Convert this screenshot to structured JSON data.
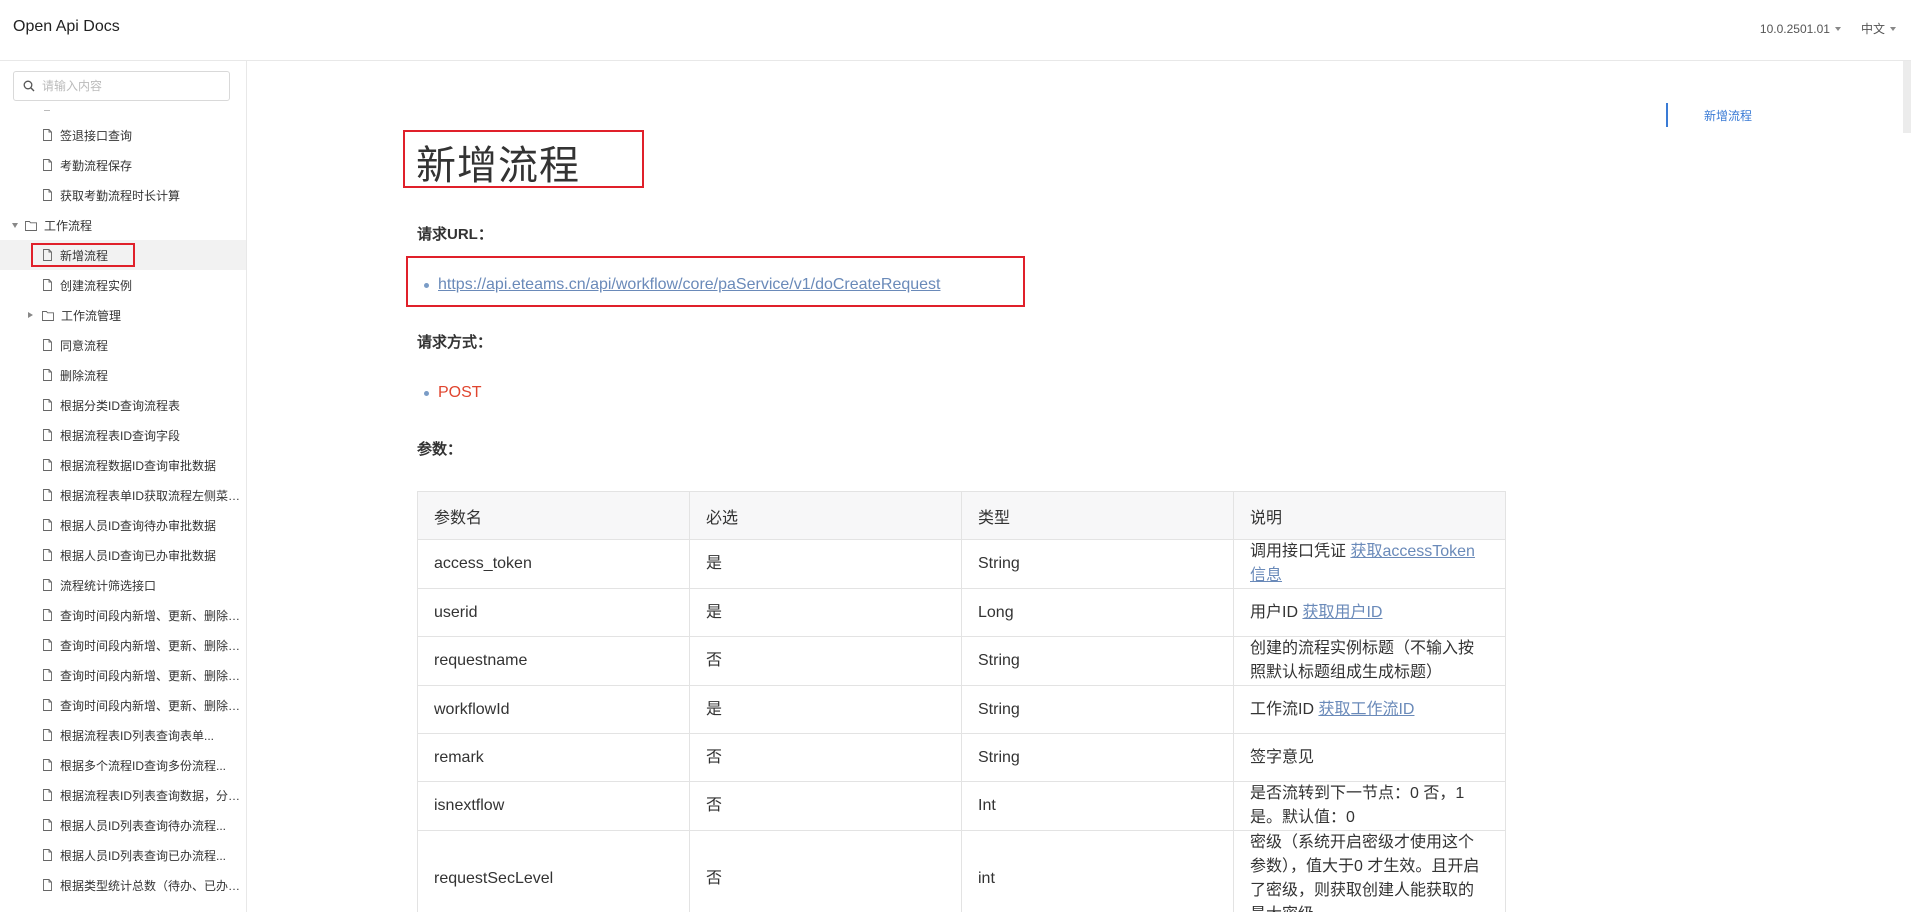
{
  "header": {
    "brand": "Open Api Docs",
    "version": "10.0.2501.01",
    "language": "中文"
  },
  "sidebar": {
    "search_placeholder": "请输入内容",
    "items_top": [
      {
        "label": "签退接口查询"
      },
      {
        "label": "考勤流程保存"
      },
      {
        "label": "获取考勤流程时长计算"
      }
    ],
    "folder": {
      "label": "工作流程"
    },
    "items": [
      {
        "label": "新增流程",
        "active": true
      },
      {
        "label": "创建流程实例"
      },
      {
        "label": "工作流管理",
        "folder": true
      },
      {
        "label": "同意流程"
      },
      {
        "label": "删除流程"
      },
      {
        "label": "根据分类ID查询流程表"
      },
      {
        "label": "根据流程表ID查询字段"
      },
      {
        "label": "根据流程数据ID查询审批数据"
      },
      {
        "label": "根据流程表单ID获取流程左侧菜单..."
      },
      {
        "label": "根据人员ID查询待办审批数据"
      },
      {
        "label": "根据人员ID查询已办审批数据"
      },
      {
        "label": "流程统计筛选接口"
      },
      {
        "label": "查询时间段内新增、更新、删除的..."
      },
      {
        "label": "查询时间段内新增、更新、删除三..."
      },
      {
        "label": "查询时间段内新增、更新、删除的..."
      },
      {
        "label": "查询时间段内新增、更新、删除三..."
      },
      {
        "label": "根据流程表ID列表查询表单..."
      },
      {
        "label": "根据多个流程ID查询多份流程..."
      },
      {
        "label": "根据流程表ID列表查询数据，分页..."
      },
      {
        "label": "根据人员ID列表查询待办流程..."
      },
      {
        "label": "根据人员ID列表查询已办流程..."
      },
      {
        "label": "根据类型统计总数（待办、已办、..."
      }
    ]
  },
  "main": {
    "title": "新增流程",
    "url_heading": "请求URL：",
    "url": "https://api.eteams.cn/api/workflow/core/paService/v1/doCreateRequest",
    "method_heading": "请求方式：",
    "method": "POST",
    "params_heading": "参数：",
    "table": {
      "headers": [
        "参数名",
        "必选",
        "类型",
        "说明"
      ],
      "rows": [
        {
          "name": "access_token",
          "required": "是",
          "type": "String",
          "desc": "调用接口凭证 ",
          "link": "获取accessToken信息"
        },
        {
          "name": "userid",
          "required": "是",
          "type": "Long",
          "desc": "用户ID ",
          "link": "获取用户ID"
        },
        {
          "name": "requestname",
          "required": "否",
          "type": "String",
          "desc": "创建的流程实例标题（不输入按照默认标题组成生成标题）",
          "link": ""
        },
        {
          "name": "workflowId",
          "required": "是",
          "type": "String",
          "desc": "工作流ID ",
          "link": "获取工作流ID"
        },
        {
          "name": "remark",
          "required": "否",
          "type": "String",
          "desc": "签字意见",
          "link": ""
        },
        {
          "name": "isnextflow",
          "required": "否",
          "type": "Int",
          "desc": "是否流转到下一节点：0 否，1 是。默认值：0",
          "link": ""
        },
        {
          "name": "requestSecLevel",
          "required": "否",
          "type": "int",
          "desc": "密级（系统开启密级才使用这个参数），值大于0 才生效。且开启了密级，则获取创建人能获取的最大密级",
          "link": ""
        }
      ]
    }
  },
  "toc": {
    "items": [
      {
        "label": "新增流程"
      }
    ]
  },
  "colors": {
    "highlight_box": "#e0202a",
    "link": "#6a8ab9",
    "post": "#e0452f",
    "toc_accent": "#3a7bd5"
  }
}
